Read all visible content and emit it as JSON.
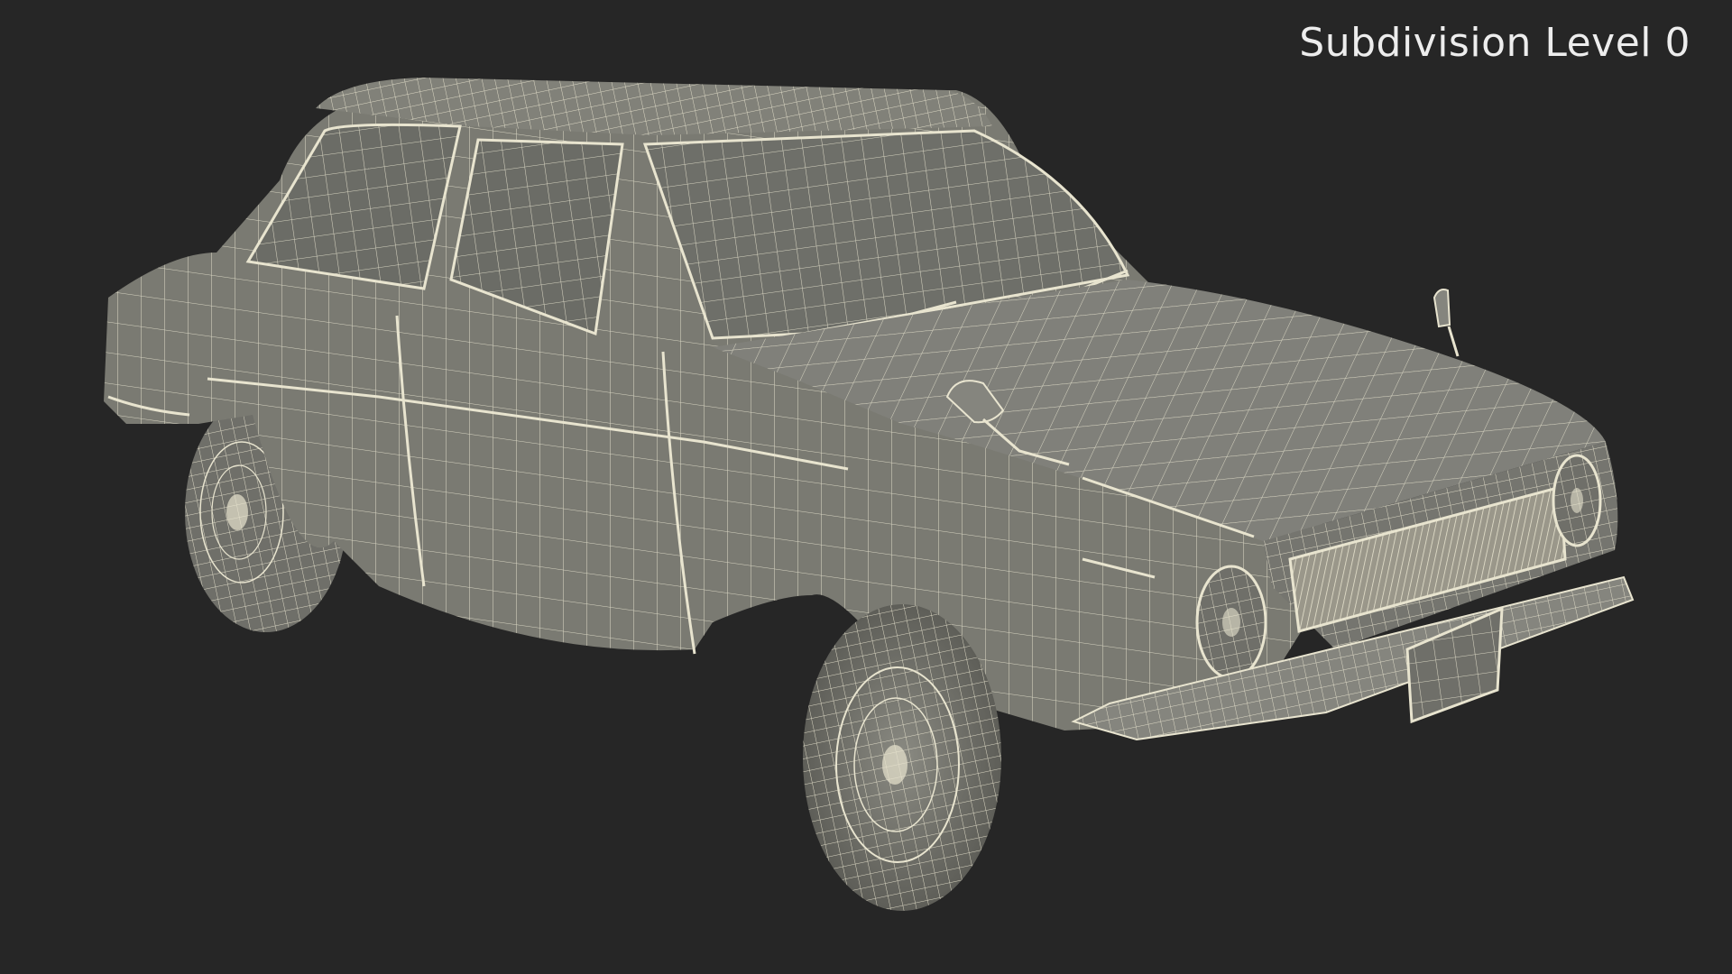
{
  "overlay": {
    "label": "Subdivision Level 0"
  },
  "colors": {
    "background": "#262626",
    "body_fill": "#7c7c74",
    "glass_fill": "#6d6e68",
    "wire": "#e8e4cf",
    "label": "#ededed"
  },
  "subject": {
    "icon": "wireframe-car-model-icon"
  }
}
